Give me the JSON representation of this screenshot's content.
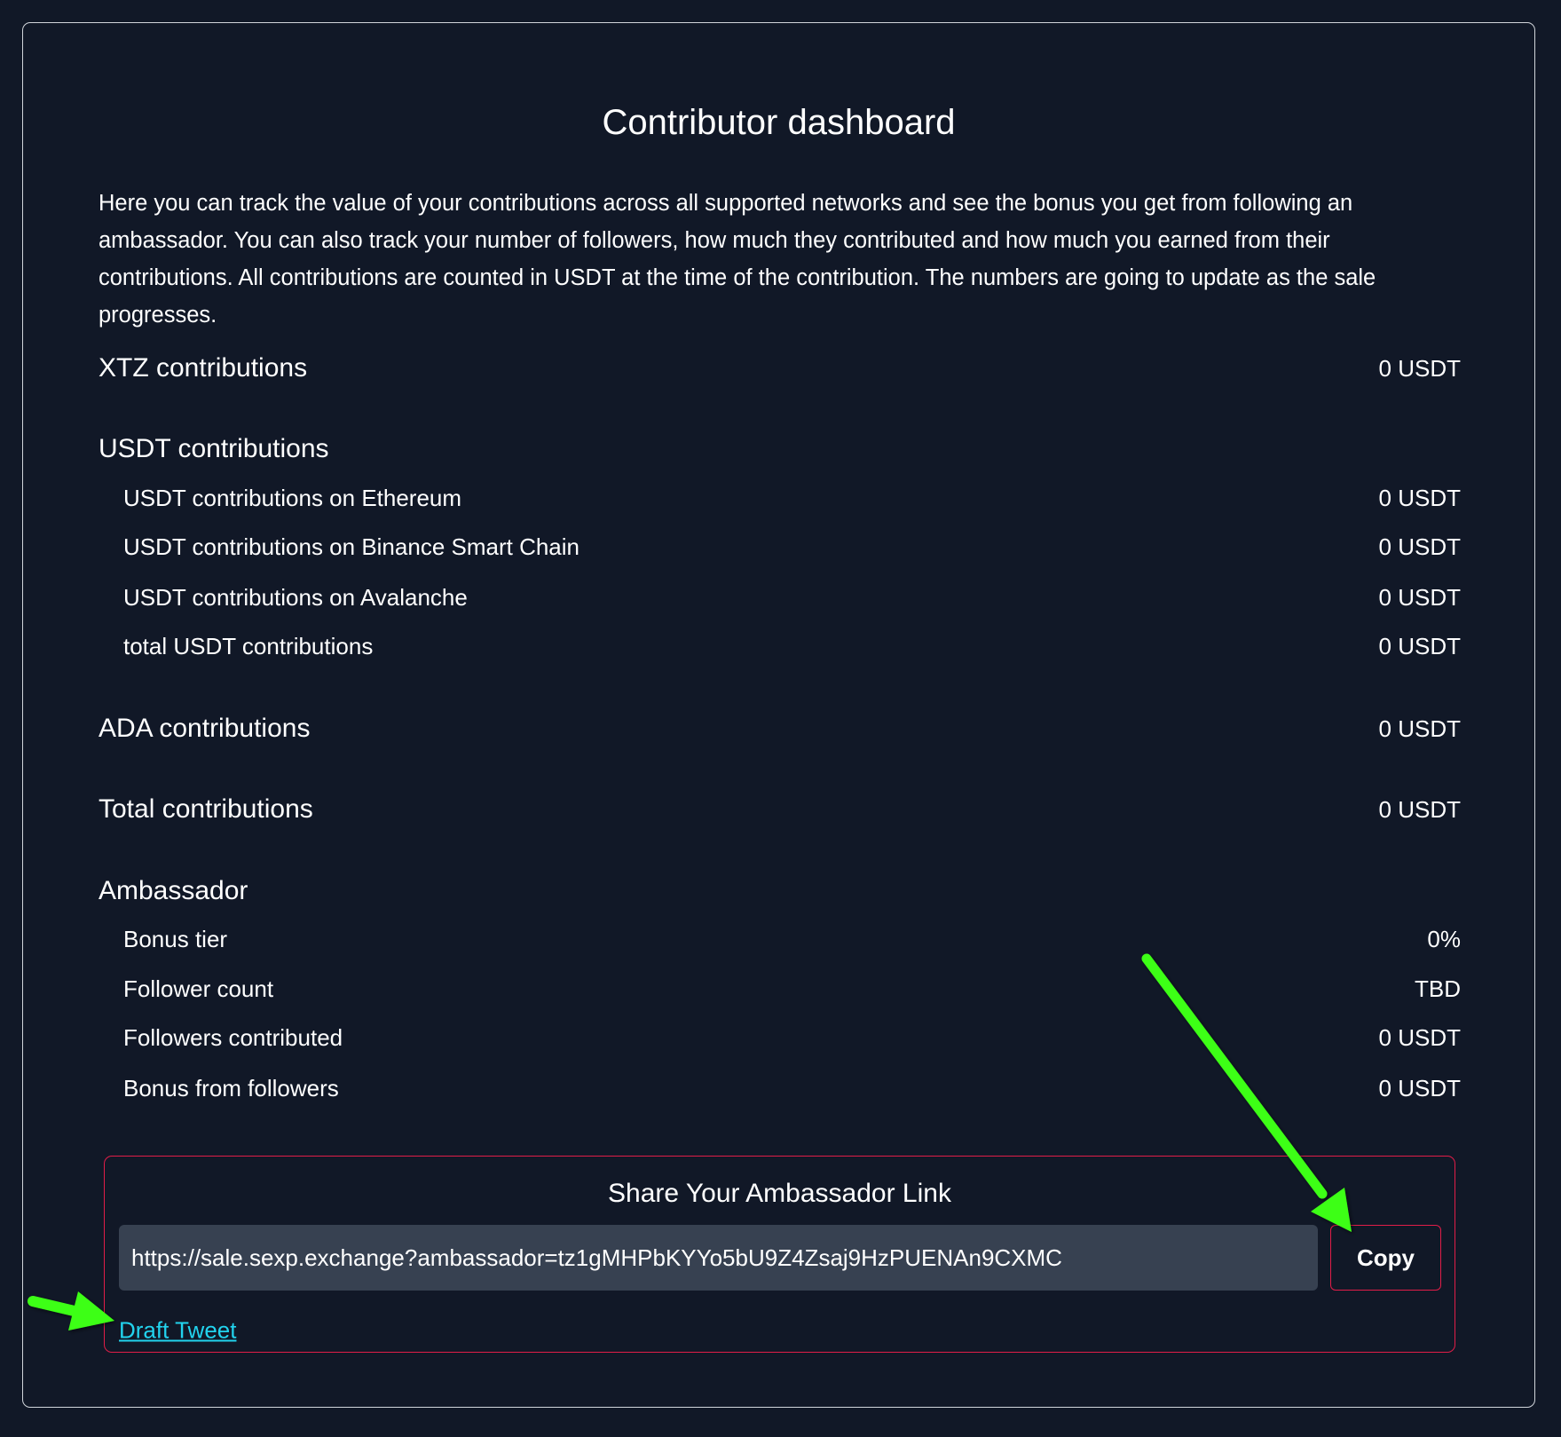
{
  "page": {
    "title": "Contributor dashboard",
    "intro": "Here you can track the value of your contributions across all supported networks and see the bonus you get from following an ambassador. You can also track your number of followers, how much they contributed and how much you earned from their contributions. All contributions are counted in USDT at the time of the contribution. The numbers are going to update as the sale progresses."
  },
  "contributions": {
    "xtz": {
      "label": "XTZ contributions",
      "value": "0 USDT"
    },
    "usdt": {
      "label": "USDT contributions",
      "items": [
        {
          "label": "USDT contributions on Ethereum",
          "value": "0 USDT"
        },
        {
          "label": "USDT contributions on Binance Smart Chain",
          "value": "0 USDT"
        },
        {
          "label": "USDT contributions on Avalanche",
          "value": "0 USDT"
        },
        {
          "label": "total USDT contributions",
          "value": "0 USDT"
        }
      ]
    },
    "ada": {
      "label": "ADA contributions",
      "value": "0 USDT"
    },
    "total": {
      "label": "Total contributions",
      "value": "0 USDT"
    }
  },
  "ambassador": {
    "label": "Ambassador",
    "items": [
      {
        "label": "Bonus tier",
        "value": "0%"
      },
      {
        "label": "Follower count",
        "value": "TBD"
      },
      {
        "label": "Followers contributed",
        "value": "0 USDT"
      },
      {
        "label": "Bonus from followers",
        "value": "0 USDT"
      }
    ]
  },
  "share": {
    "title": "Share Your Ambassador Link",
    "link": "https://sale.sexp.exchange?ambassador=tz1gMHPbKYYo5bU9Z4Zsaj9HzPUENAn9CXMC",
    "copy_label": "Copy",
    "draft_tweet_label": "Draft Tweet"
  },
  "colors": {
    "background": "#111827",
    "accent_border": "#e11d48",
    "link": "#22d3ee",
    "input_bg": "#374151",
    "annotation_arrow": "#3cff14"
  }
}
